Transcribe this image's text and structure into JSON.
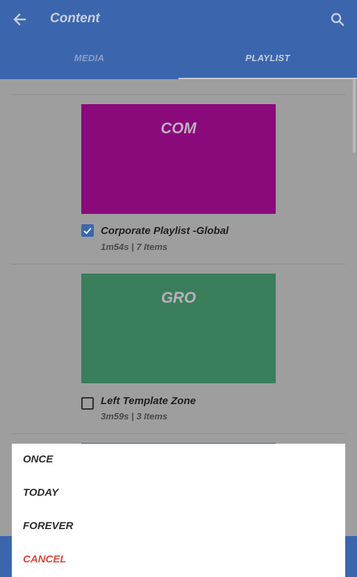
{
  "header": {
    "title": "Content",
    "tabs": [
      {
        "label": "MEDIA",
        "active": false
      },
      {
        "label": "PLAYLIST",
        "active": true
      }
    ]
  },
  "playlists": [
    {
      "thumb_label": "COM",
      "thumb_color": "#8a0a7b",
      "title": "Corporate Playlist -Global",
      "meta": "1m54s | 7 Items",
      "checked": true
    },
    {
      "thumb_label": "GRO",
      "thumb_color": "#3a7e5c",
      "title": "Left Template Zone",
      "meta": "3m59s | 3 Items",
      "checked": false
    }
  ],
  "menu": {
    "options": [
      "ONCE",
      "TODAY",
      "FOREVER"
    ],
    "cancel": "CANCEL"
  },
  "colors": {
    "app_bar": "#3b66ae",
    "cancel": "#e0463c",
    "overlay_background": "#9e9e9e"
  },
  "icons": [
    "back-arrow-icon",
    "search-icon",
    "checkmark-icon"
  ]
}
